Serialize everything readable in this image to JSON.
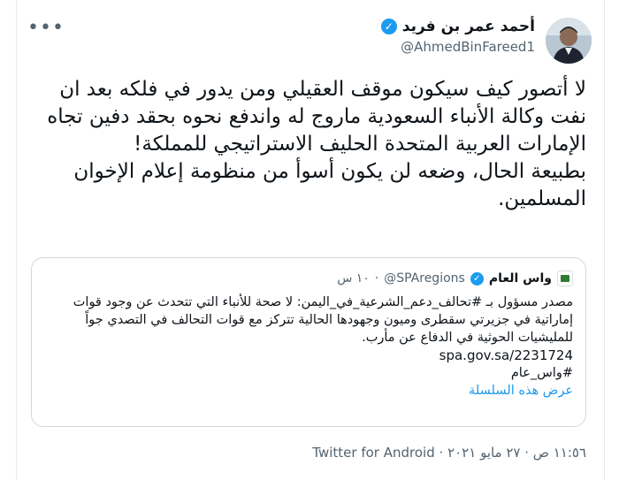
{
  "tweet": {
    "author_name": "أحمد عمر بن فريد",
    "author_handle": "@AhmedBinFareed1",
    "more_icon": "•••",
    "verified_glyph": "✓",
    "text_lines": [
      "لا أتصور كيف سيكون موقف العقيلي ومن يدور في فلكه بعد ان نفت وكالة الأنباء السعودية ماروج له واندفع نحوه بحقد دفين تجاه الإمارات العربية المتحدة الحليف الاستراتيجي للمملكة!",
      "بطبيعة الحال،  وضعه لن يكون أسوأ من منظومة إعلام الإخوان المسلمين."
    ],
    "quoted": {
      "name": "واس العام",
      "handle": "@SPAregions",
      "separator": "·",
      "time": "١٠ س",
      "body": "مصدر مسؤول بـ #تحالف_دعم_الشرعية_في_اليمن: لا صحة للأنباء التي تتحدث عن وجود قوات إماراتية في جزيرتي سقطرى وميون وجهودها الحالية تتركز مع قوات التحالف في التصدي جواً للمليشيات الحوثية في الدفاع عن مأرب.",
      "link": "spa.gov.sa/2231724",
      "hashtag": "#واس_عام",
      "show_thread": "عرض هذه السلسلة"
    },
    "footer": {
      "time_date": "١١:٥٦ ص · ٢٧ مايو ٢٠٢١ ·",
      "source": "Twitter for Android"
    }
  }
}
